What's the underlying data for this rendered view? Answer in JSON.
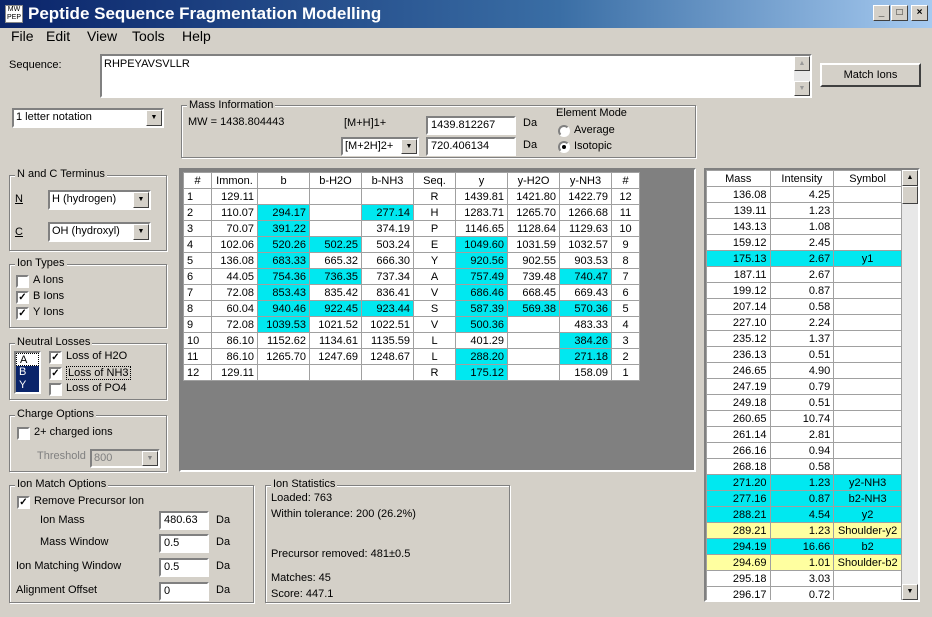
{
  "window": {
    "title": "Peptide Sequence Fragmentation Modelling",
    "controls": [
      "_",
      "□",
      "×"
    ]
  },
  "menu": [
    "File",
    "Edit",
    "View",
    "Tools",
    "Help"
  ],
  "sequence": {
    "label": "Sequence:",
    "value": "RHPEYAVSVLLR"
  },
  "match_button": "Match Ions",
  "notation_select": "1 letter notation",
  "mass_info": {
    "title": "Mass Information",
    "mw": "MW = 1438.804443",
    "mh1_label": "[M+H]1+",
    "mh1_value": "1439.812267",
    "mh2_select": "[M+2H]2+",
    "mh2_value": "720.406134",
    "unit": "Da",
    "element_mode": "Element Mode",
    "average": "Average",
    "isotopic": "Isotopic",
    "selected_mode": "Isotopic"
  },
  "terminus": {
    "title": "N and C Terminus",
    "n_label": "N",
    "n_value": "H (hydrogen)",
    "c_label": "C",
    "c_value": "OH (hydroxyl)"
  },
  "ion_types": {
    "title": "Ion Types",
    "items": [
      {
        "label": "A Ions",
        "checked": false
      },
      {
        "label": "B Ions",
        "checked": true
      },
      {
        "label": "Y Ions",
        "checked": true
      }
    ]
  },
  "neutral_losses": {
    "title": "Neutral Losses",
    "list": [
      "A",
      "B",
      "Y"
    ],
    "items": [
      {
        "label": "Loss of H2O",
        "checked": true
      },
      {
        "label": "Loss of NH3",
        "checked": true
      },
      {
        "label": "Loss of PO4",
        "checked": false
      }
    ]
  },
  "charge_options": {
    "title": "Charge Options",
    "charged_label": "2+ charged ions",
    "charged_checked": false,
    "threshold_label": "Threshold",
    "threshold_value": "800"
  },
  "ion_match": {
    "title": "Ion Match Options",
    "remove_label": "Remove Precursor Ion",
    "remove_checked": true,
    "ion_mass_label": "Ion Mass",
    "ion_mass_value": "480.63",
    "mass_window_label": "Mass Window",
    "mass_window_value": "0.5",
    "matching_window_label": "Ion Matching Window",
    "matching_window_value": "0.5",
    "alignment_label": "Alignment Offset",
    "alignment_value": "0",
    "unit": "Da"
  },
  "ion_stats": {
    "title": "Ion Statistics",
    "loaded": "Loaded: 763",
    "within": "Within tolerance: 200 (26.2%)",
    "precursor": "Precursor removed: 481±0.5",
    "matches": "Matches: 45",
    "score": "Score: 447.1"
  },
  "frag_table": {
    "headers": [
      "#",
      "Immon.",
      "b",
      "b-H2O",
      "b-NH3",
      "Seq.",
      "y",
      "y-H2O",
      "y-NH3",
      "#"
    ],
    "rows": [
      [
        "1",
        "129.11",
        "",
        "",
        "",
        "R",
        "1439.81",
        "1421.80",
        "1422.79",
        "12"
      ],
      [
        "2",
        "110.07",
        "294.17",
        "",
        "277.14",
        "H",
        "1283.71",
        "1265.70",
        "1266.68",
        "11"
      ],
      [
        "3",
        "70.07",
        "391.22",
        "",
        "374.19",
        "P",
        "1146.65",
        "1128.64",
        "1129.63",
        "10"
      ],
      [
        "4",
        "102.06",
        "520.26",
        "502.25",
        "503.24",
        "E",
        "1049.60",
        "1031.59",
        "1032.57",
        "9"
      ],
      [
        "5",
        "136.08",
        "683.33",
        "665.32",
        "666.30",
        "Y",
        "920.56",
        "902.55",
        "903.53",
        "8"
      ],
      [
        "6",
        "44.05",
        "754.36",
        "736.35",
        "737.34",
        "A",
        "757.49",
        "739.48",
        "740.47",
        "7"
      ],
      [
        "7",
        "72.08",
        "853.43",
        "835.42",
        "836.41",
        "V",
        "686.46",
        "668.45",
        "669.43",
        "6"
      ],
      [
        "8",
        "60.04",
        "940.46",
        "922.45",
        "923.44",
        "S",
        "587.39",
        "569.38",
        "570.36",
        "5"
      ],
      [
        "9",
        "72.08",
        "1039.53",
        "1021.52",
        "1022.51",
        "V",
        "500.36",
        "",
        "483.33",
        "4"
      ],
      [
        "10",
        "86.10",
        "1152.62",
        "1134.61",
        "1135.59",
        "L",
        "401.29",
        "",
        "384.26",
        "3"
      ],
      [
        "11",
        "86.10",
        "1265.70",
        "1247.69",
        "1248.67",
        "L",
        "288.20",
        "",
        "271.18",
        "2"
      ],
      [
        "12",
        "129.11",
        "",
        "",
        "",
        "R",
        "175.12",
        "",
        "158.09",
        "1"
      ]
    ],
    "highlights": [
      [
        1,
        2
      ],
      [
        1,
        4
      ],
      [
        2,
        2
      ],
      [
        3,
        2
      ],
      [
        3,
        3
      ],
      [
        3,
        6
      ],
      [
        4,
        2
      ],
      [
        4,
        6
      ],
      [
        5,
        2
      ],
      [
        5,
        3
      ],
      [
        5,
        6
      ],
      [
        5,
        8
      ],
      [
        6,
        2
      ],
      [
        6,
        6
      ],
      [
        7,
        2
      ],
      [
        7,
        3
      ],
      [
        7,
        4
      ],
      [
        7,
        6
      ],
      [
        7,
        7
      ],
      [
        7,
        8
      ],
      [
        8,
        2
      ],
      [
        8,
        6
      ],
      [
        9,
        8
      ],
      [
        10,
        6
      ],
      [
        10,
        8
      ],
      [
        11,
        6
      ]
    ]
  },
  "peaks": {
    "headers": [
      "Mass",
      "Intensity",
      "Symbol"
    ],
    "rows": [
      [
        "136.08",
        "4.25",
        "",
        ""
      ],
      [
        "139.11",
        "1.23",
        "",
        ""
      ],
      [
        "143.13",
        "1.08",
        "",
        ""
      ],
      [
        "159.12",
        "2.45",
        "",
        ""
      ],
      [
        "175.13",
        "2.67",
        "y1",
        "cyan"
      ],
      [
        "187.11",
        "2.67",
        "",
        ""
      ],
      [
        "199.12",
        "0.87",
        "",
        ""
      ],
      [
        "207.14",
        "0.58",
        "",
        ""
      ],
      [
        "227.10",
        "2.24",
        "",
        ""
      ],
      [
        "235.12",
        "1.37",
        "",
        ""
      ],
      [
        "236.13",
        "0.51",
        "",
        ""
      ],
      [
        "246.65",
        "4.90",
        "",
        ""
      ],
      [
        "247.19",
        "0.79",
        "",
        ""
      ],
      [
        "249.18",
        "0.51",
        "",
        ""
      ],
      [
        "260.65",
        "10.74",
        "",
        ""
      ],
      [
        "261.14",
        "2.81",
        "",
        ""
      ],
      [
        "266.16",
        "0.94",
        "",
        ""
      ],
      [
        "268.18",
        "0.58",
        "",
        ""
      ],
      [
        "271.20",
        "1.23",
        "y2-NH3",
        "cyan"
      ],
      [
        "277.16",
        "0.87",
        "b2-NH3",
        "cyan"
      ],
      [
        "288.21",
        "4.54",
        "y2",
        "cyan"
      ],
      [
        "289.21",
        "1.23",
        "Shoulder-y2",
        "yellow"
      ],
      [
        "294.19",
        "16.66",
        "b2",
        "cyan"
      ],
      [
        "294.69",
        "1.01",
        "Shoulder-b2",
        "yellow"
      ],
      [
        "295.18",
        "3.03",
        "",
        ""
      ],
      [
        "296.17",
        "0.72",
        "",
        ""
      ]
    ]
  }
}
